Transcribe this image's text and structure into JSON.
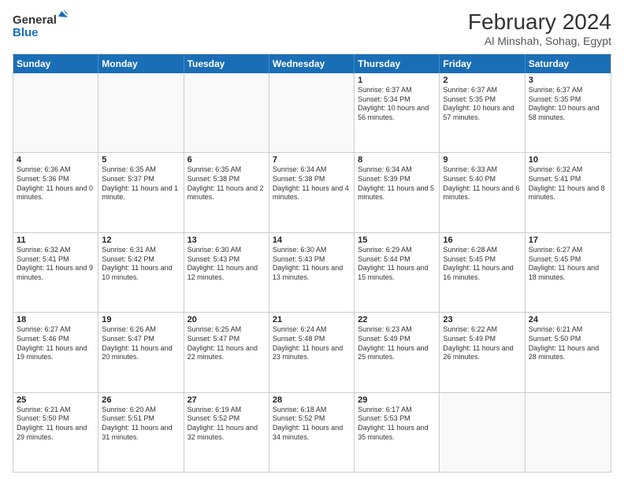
{
  "header": {
    "logo_general": "General",
    "logo_blue": "Blue",
    "month_year": "February 2024",
    "location": "Al Minshah, Sohag, Egypt"
  },
  "days_of_week": [
    "Sunday",
    "Monday",
    "Tuesday",
    "Wednesday",
    "Thursday",
    "Friday",
    "Saturday"
  ],
  "weeks": [
    [
      {
        "day": "",
        "info": ""
      },
      {
        "day": "",
        "info": ""
      },
      {
        "day": "",
        "info": ""
      },
      {
        "day": "",
        "info": ""
      },
      {
        "day": "1",
        "info": "Sunrise: 6:37 AM\nSunset: 5:34 PM\nDaylight: 10 hours and 56 minutes."
      },
      {
        "day": "2",
        "info": "Sunrise: 6:37 AM\nSunset: 5:35 PM\nDaylight: 10 hours and 57 minutes."
      },
      {
        "day": "3",
        "info": "Sunrise: 6:37 AM\nSunset: 5:35 PM\nDaylight: 10 hours and 58 minutes."
      }
    ],
    [
      {
        "day": "4",
        "info": "Sunrise: 6:36 AM\nSunset: 5:36 PM\nDaylight: 11 hours and 0 minutes."
      },
      {
        "day": "5",
        "info": "Sunrise: 6:35 AM\nSunset: 5:37 PM\nDaylight: 11 hours and 1 minute."
      },
      {
        "day": "6",
        "info": "Sunrise: 6:35 AM\nSunset: 5:38 PM\nDaylight: 11 hours and 2 minutes."
      },
      {
        "day": "7",
        "info": "Sunrise: 6:34 AM\nSunset: 5:38 PM\nDaylight: 11 hours and 4 minutes."
      },
      {
        "day": "8",
        "info": "Sunrise: 6:34 AM\nSunset: 5:39 PM\nDaylight: 11 hours and 5 minutes."
      },
      {
        "day": "9",
        "info": "Sunrise: 6:33 AM\nSunset: 5:40 PM\nDaylight: 11 hours and 6 minutes."
      },
      {
        "day": "10",
        "info": "Sunrise: 6:32 AM\nSunset: 5:41 PM\nDaylight: 11 hours and 8 minutes."
      }
    ],
    [
      {
        "day": "11",
        "info": "Sunrise: 6:32 AM\nSunset: 5:41 PM\nDaylight: 11 hours and 9 minutes."
      },
      {
        "day": "12",
        "info": "Sunrise: 6:31 AM\nSunset: 5:42 PM\nDaylight: 11 hours and 10 minutes."
      },
      {
        "day": "13",
        "info": "Sunrise: 6:30 AM\nSunset: 5:43 PM\nDaylight: 11 hours and 12 minutes."
      },
      {
        "day": "14",
        "info": "Sunrise: 6:30 AM\nSunset: 5:43 PM\nDaylight: 11 hours and 13 minutes."
      },
      {
        "day": "15",
        "info": "Sunrise: 6:29 AM\nSunset: 5:44 PM\nDaylight: 11 hours and 15 minutes."
      },
      {
        "day": "16",
        "info": "Sunrise: 6:28 AM\nSunset: 5:45 PM\nDaylight: 11 hours and 16 minutes."
      },
      {
        "day": "17",
        "info": "Sunrise: 6:27 AM\nSunset: 5:45 PM\nDaylight: 11 hours and 18 minutes."
      }
    ],
    [
      {
        "day": "18",
        "info": "Sunrise: 6:27 AM\nSunset: 5:46 PM\nDaylight: 11 hours and 19 minutes."
      },
      {
        "day": "19",
        "info": "Sunrise: 6:26 AM\nSunset: 5:47 PM\nDaylight: 11 hours and 20 minutes."
      },
      {
        "day": "20",
        "info": "Sunrise: 6:25 AM\nSunset: 5:47 PM\nDaylight: 11 hours and 22 minutes."
      },
      {
        "day": "21",
        "info": "Sunrise: 6:24 AM\nSunset: 5:48 PM\nDaylight: 11 hours and 23 minutes."
      },
      {
        "day": "22",
        "info": "Sunrise: 6:23 AM\nSunset: 5:49 PM\nDaylight: 11 hours and 25 minutes."
      },
      {
        "day": "23",
        "info": "Sunrise: 6:22 AM\nSunset: 5:49 PM\nDaylight: 11 hours and 26 minutes."
      },
      {
        "day": "24",
        "info": "Sunrise: 6:21 AM\nSunset: 5:50 PM\nDaylight: 11 hours and 28 minutes."
      }
    ],
    [
      {
        "day": "25",
        "info": "Sunrise: 6:21 AM\nSunset: 5:50 PM\nDaylight: 11 hours and 29 minutes."
      },
      {
        "day": "26",
        "info": "Sunrise: 6:20 AM\nSunset: 5:51 PM\nDaylight: 11 hours and 31 minutes."
      },
      {
        "day": "27",
        "info": "Sunrise: 6:19 AM\nSunset: 5:52 PM\nDaylight: 11 hours and 32 minutes."
      },
      {
        "day": "28",
        "info": "Sunrise: 6:18 AM\nSunset: 5:52 PM\nDaylight: 11 hours and 34 minutes."
      },
      {
        "day": "29",
        "info": "Sunrise: 6:17 AM\nSunset: 5:53 PM\nDaylight: 11 hours and 35 minutes."
      },
      {
        "day": "",
        "info": ""
      },
      {
        "day": "",
        "info": ""
      }
    ]
  ]
}
